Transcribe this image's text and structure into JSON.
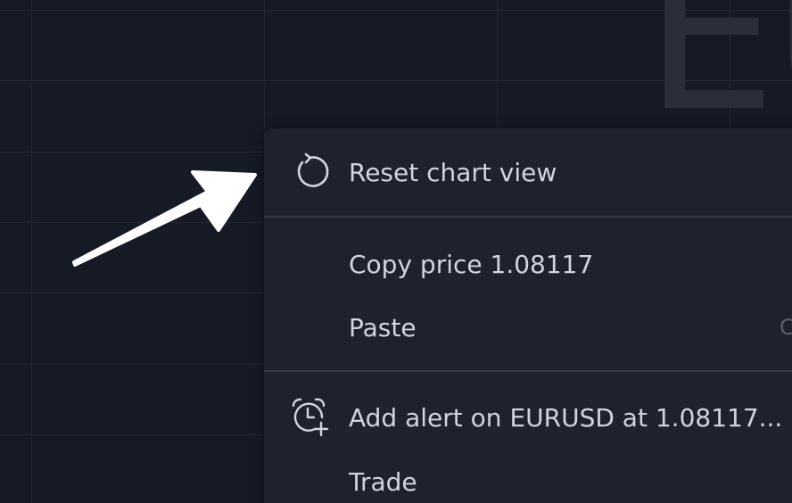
{
  "chart": {
    "watermark_text": "EU",
    "background_color": "#161a25",
    "grid_color": "#232734"
  },
  "context_menu": {
    "background_color": "#1e222d",
    "text_color": "#d1d4dc",
    "items": [
      {
        "label": "Reset chart view",
        "icon": "reset-icon"
      },
      {
        "label": "Copy price 1.08117"
      },
      {
        "label": "Paste",
        "shortcut": "C"
      },
      {
        "label": "Add alert on EURUSD at 1.08117...",
        "icon": "alarm-clock-plus-icon"
      },
      {
        "label": "Trade"
      }
    ]
  },
  "annotation": {
    "arrow_color": "#ffffff",
    "icon": "pointer-arrow-icon"
  }
}
